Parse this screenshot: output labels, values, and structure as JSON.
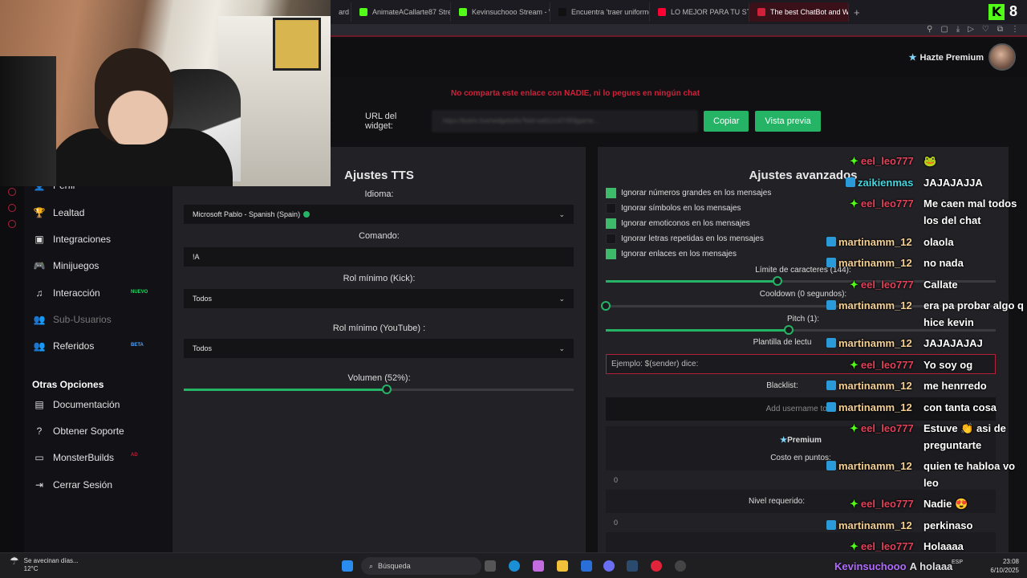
{
  "browser": {
    "tabs": [
      {
        "label": "ard",
        "color": "#333333"
      },
      {
        "label": "AnimateACallarte87 Strea",
        "color": "#53fc18"
      },
      {
        "label": "Kevinsuchooo Stream - W",
        "color": "#53fc18"
      },
      {
        "label": "Encuentra 'traer uniforme",
        "color": "#111111"
      },
      {
        "label": "LO MEJOR PARA TU STR",
        "color": "#ff0033"
      },
      {
        "label": "The best ChatBot and Wi",
        "color": "#d1213a",
        "active": true
      }
    ],
    "new_tab": "+",
    "brand_logo": "K",
    "brand_number": "8"
  },
  "header": {
    "premium_label": "Hazte Premium",
    "warning": "No comparta este enlace con NADIE, ni lo pegues en ningún chat",
    "widget_url_label": "URL del widget:",
    "widget_url_value": "https://botrix.live/widgets/tts?bid=xa61zcd7r9f3jgame...",
    "copy_button": "Copiar",
    "preview_button": "Vista previa"
  },
  "sidebar": {
    "items": [
      {
        "label": "Perfil",
        "icon": "user-icon",
        "glyph": "👤"
      },
      {
        "label": "Lealtad",
        "icon": "trophy-icon",
        "glyph": "🏆"
      },
      {
        "label": "Integraciones",
        "icon": "integrations-icon",
        "glyph": "▣"
      },
      {
        "label": "Minijuegos",
        "icon": "gamepad-icon",
        "glyph": "🎮"
      },
      {
        "label": "Interacción",
        "icon": "music-icon",
        "glyph": "♫",
        "badge": "NUEVO"
      },
      {
        "label": "Sub-Usuarios",
        "icon": "users-icon",
        "glyph": "👥"
      },
      {
        "label": "Referidos",
        "icon": "referrals-icon",
        "glyph": "👥",
        "badge": "BETA"
      }
    ],
    "section_title": "Otras Opciones",
    "other_items": [
      {
        "label": "Documentación",
        "icon": "document-icon",
        "glyph": "▤"
      },
      {
        "label": "Obtener Soporte",
        "icon": "help-icon",
        "glyph": "?"
      },
      {
        "label": "MonsterBuilds",
        "icon": "monitor-icon",
        "glyph": "▭",
        "badge": "AD"
      },
      {
        "label": "Cerrar Sesión",
        "icon": "logout-icon",
        "glyph": "⇥"
      }
    ]
  },
  "tts": {
    "title": "Ajustes TTS",
    "idioma_label": "Idioma:",
    "idioma_value": "Microsoft Pablo - Spanish (Spain)",
    "comando_label": "Comando:",
    "comando_value": "!A",
    "rol_kick_label": "Rol mínimo (Kick):",
    "rol_kick_value": "Todos",
    "rol_youtube_label": "Rol mínimo (YouTube) :",
    "rol_youtube_value": "Todos",
    "volumen_label": "Volumen (52%):",
    "volumen_value": 0.52
  },
  "advanced": {
    "title": "Ajustes avanzados",
    "options": [
      {
        "label": "Ignorar números grandes en los mensajes",
        "checked": true
      },
      {
        "label": "Ignorar símbolos en los mensajes",
        "checked": false
      },
      {
        "label": "Ignorar emoticonos en los mensajes",
        "checked": true
      },
      {
        "label": "Ignorar letras repetidas en los mensajes",
        "checked": false
      },
      {
        "label": "Ignorar enlaces en los mensajes",
        "checked": true
      }
    ],
    "char_limit_label": "Límite de caracteres (144):",
    "char_limit_value": 0.44,
    "cooldown_label": "Cooldown (0 segundos):",
    "cooldown_value": 0,
    "pitch_label": "Pitch (1):",
    "pitch_value": 0.47,
    "template_label": "Plantilla de lectu",
    "template_placeholder": "Ejemplo: $(sender) dice:",
    "blacklist_label": "Blacklist:",
    "blacklist_placeholder": "Add username to bl",
    "premium_title": "Premium",
    "cost_label": "Costo en puntos:",
    "cost_value": "0",
    "level_label": "Nivel requerido:",
    "level_value": "0"
  },
  "chat": [
    {
      "user": "eel_leo777",
      "text": "🐸",
      "platform": "kick",
      "color": "#e3415a"
    },
    {
      "user": "zaikienmas",
      "text": "JAJAJAJJA",
      "platform": "yt",
      "color": "#48d6e0"
    },
    {
      "user": "eel_leo777",
      "text": "Me caen mal todos los del chat",
      "platform": "kick",
      "color": "#e3415a"
    },
    {
      "user": "martinamm_12",
      "text": "olaola",
      "platform": "yt",
      "color": "#f4cf93"
    },
    {
      "user": "martinamm_12",
      "text": "no nada",
      "platform": "yt",
      "color": "#f4cf93"
    },
    {
      "user": "eel_leo777",
      "text": "Callate",
      "platform": "kick",
      "color": "#e3415a"
    },
    {
      "user": "martinamm_12",
      "text": "era pa probar algo q hice kevin",
      "platform": "yt",
      "color": "#f4cf93"
    },
    {
      "user": "martinamm_12",
      "text": "JAJAJAJAJ",
      "platform": "yt",
      "color": "#f4cf93"
    },
    {
      "user": "eel_leo777",
      "text": "Yo soy og",
      "platform": "kick",
      "color": "#e3415a"
    },
    {
      "user": "martinamm_12",
      "text": "me henrredo",
      "platform": "yt",
      "color": "#f4cf93"
    },
    {
      "user": "martinamm_12",
      "text": "con tanta cosa",
      "platform": "yt",
      "color": "#f4cf93"
    },
    {
      "user": "eel_leo777",
      "text": "Estuve 👏 asi de preguntarte",
      "platform": "kick",
      "color": "#e3415a"
    },
    {
      "user": "martinamm_12",
      "text": "quien te habloa vo leo",
      "platform": "yt",
      "color": "#f4cf93"
    },
    {
      "user": "eel_leo777",
      "text": "Nadie 😍",
      "platform": "kick",
      "color": "#e3415a"
    },
    {
      "user": "martinamm_12",
      "text": "perkinaso",
      "platform": "yt",
      "color": "#f4cf93"
    },
    {
      "user": "eel_leo777",
      "text": "Holaaaa",
      "platform": "kick",
      "color": "#e3415a"
    }
  ],
  "overlay": {
    "kick_user": "Kevinsuchooo",
    "kick_text": "A holaaa"
  },
  "taskbar": {
    "weather_title": "Se avecinan días...",
    "weather_temp": "12°C",
    "search_placeholder": "Búsqueda",
    "time": "23:08",
    "date": "6/10/2025",
    "lang": "ESP"
  }
}
